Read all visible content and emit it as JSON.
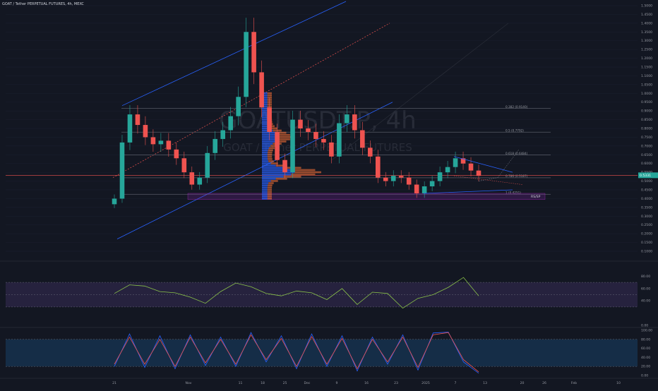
{
  "chart_data": {
    "type": "line",
    "title": "GOAT / Tether PERPETUAL FUTURES, 4h, MEXC",
    "watermark": {
      "symbol": "GOATUSDT.P, 4h",
      "name": "GOAT / Tether PERPETUAL FUTURES"
    },
    "x_ticks": [
      "21",
      "Nov",
      "11",
      "18",
      "25",
      "Dec",
      "9",
      "16",
      "23",
      "2025",
      "7",
      "13",
      "20",
      "26",
      "Feb",
      "10"
    ],
    "x_tick_positions": [
      1,
      11,
      18,
      21,
      24,
      27,
      31,
      35,
      39,
      43,
      47,
      51,
      56,
      59,
      63,
      69
    ],
    "price_axis": {
      "ylim": [
        0.1,
        1.5
      ],
      "ticks": [
        "1.5000",
        "1.4500",
        "1.4000",
        "1.3500",
        "1.3000",
        "1.2500",
        "1.2000",
        "1.1500",
        "1.1000",
        "1.0500",
        "1.0000",
        "0.9500",
        "0.9000",
        "0.8500",
        "0.8000",
        "0.7500",
        "0.7000",
        "0.6500",
        "0.6000",
        "0.5500",
        "0.5000",
        "0.4500",
        "0.4000",
        "0.3500",
        "0.3000",
        "0.2500",
        "0.2000",
        "0.1500",
        "0.1000"
      ],
      "last_price": 0.5331,
      "last_price_label": "0.5331"
    },
    "candles": {
      "up_color": "#26a69a",
      "down_color": "#ef5350",
      "x": [
        0,
        1,
        2,
        3,
        4,
        5,
        6,
        7,
        8,
        9,
        10,
        11,
        12,
        13,
        14,
        15,
        16,
        17,
        18,
        19,
        20,
        21,
        22,
        23,
        24,
        25,
        26,
        27,
        28,
        29,
        30,
        31,
        32,
        33,
        34,
        35,
        36,
        37,
        38,
        39,
        40,
        41,
        42,
        43,
        44,
        45,
        46,
        47
      ],
      "close": [
        0.4,
        0.72,
        0.88,
        0.82,
        0.75,
        0.71,
        0.73,
        0.68,
        0.63,
        0.55,
        0.48,
        0.52,
        0.66,
        0.74,
        0.79,
        0.87,
        0.98,
        1.35,
        1.12,
        0.92,
        0.78,
        0.62,
        0.55,
        0.85,
        0.8,
        0.78,
        0.74,
        0.72,
        0.64,
        0.83,
        0.88,
        0.79,
        0.69,
        0.64,
        0.52,
        0.5,
        0.53,
        0.52,
        0.48,
        0.43,
        0.47,
        0.5,
        0.55,
        0.58,
        0.63,
        0.6,
        0.56,
        0.53
      ]
    },
    "fib_levels": [
      {
        "ratio": "0.382",
        "value": "0.9140",
        "label": "0.382 (0.9140)",
        "price": 0.914
      },
      {
        "ratio": "0.5",
        "value": "0.7792",
        "label": "0.5 (0.7792)",
        "price": 0.7792
      },
      {
        "ratio": "0.618",
        "value": "0.6484",
        "label": "0.618 (0.6484)",
        "price": 0.6484
      },
      {
        "ratio": "0.786",
        "value": "0.5187",
        "label": "0.786 (0.5187)",
        "price": 0.5187
      },
      {
        "ratio": "1",
        "value": "0.4251",
        "label": "1 (0.4251)",
        "price": 0.4251
      }
    ],
    "zone_label": "RS/SP",
    "rsi": {
      "ylim": [
        0,
        100
      ],
      "ticks": [
        "80.00",
        "60.00",
        "40.00",
        "0.00"
      ],
      "upper": 70,
      "mid": 50,
      "lower": 30,
      "x": [
        0,
        2,
        4,
        6,
        8,
        10,
        12,
        14,
        16,
        18,
        20,
        22,
        24,
        26,
        28,
        30,
        32,
        34,
        36,
        38,
        40,
        42,
        44,
        46,
        48
      ],
      "values": [
        52,
        66,
        64,
        55,
        53,
        46,
        36,
        55,
        69,
        63,
        52,
        48,
        56,
        53,
        42,
        60,
        34,
        54,
        52,
        28,
        44,
        50,
        62,
        78,
        48
      ]
    },
    "stoch": {
      "ylim": [
        0,
        100
      ],
      "ticks": [
        "100.00",
        "80.00",
        "60.00",
        "40.00",
        "20.00",
        "0.00"
      ],
      "upper": 80,
      "lower": 20,
      "x": [
        0,
        2,
        4,
        6,
        8,
        10,
        12,
        14,
        16,
        18,
        20,
        22,
        24,
        26,
        28,
        30,
        32,
        34,
        36,
        38,
        40,
        42,
        44,
        46,
        48
      ],
      "k": [
        20,
        92,
        18,
        88,
        15,
        90,
        22,
        85,
        20,
        95,
        30,
        88,
        15,
        92,
        20,
        88,
        10,
        85,
        25,
        90,
        12,
        94,
        96,
        30,
        5
      ],
      "d": [
        25,
        85,
        25,
        80,
        20,
        85,
        28,
        80,
        25,
        90,
        35,
        82,
        20,
        86,
        25,
        82,
        15,
        80,
        30,
        85,
        18,
        90,
        95,
        35,
        8
      ]
    }
  }
}
